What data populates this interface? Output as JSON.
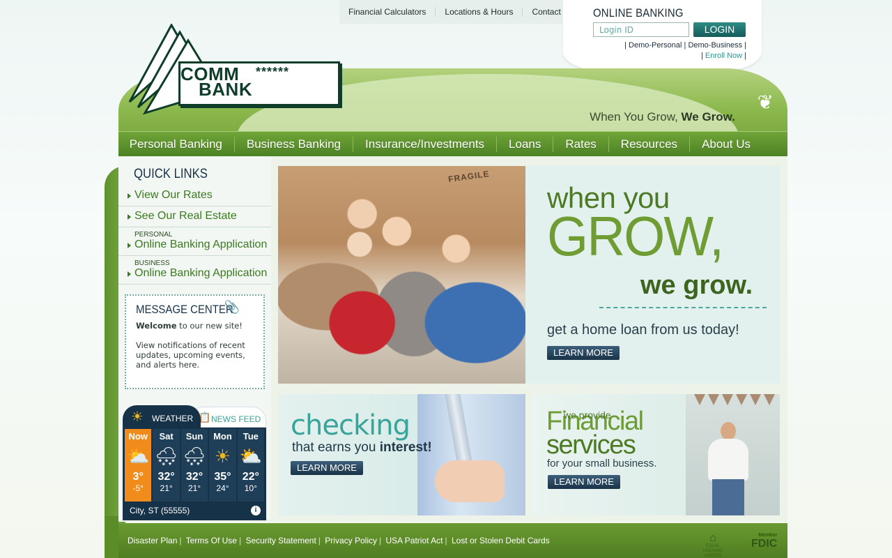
{
  "util_nav": [
    "Financial Calculators",
    "Locations & Hours",
    "Contact Us"
  ],
  "online_banking": {
    "title": "ONLINE BANKING",
    "login_placeholder": "Login ID",
    "login_button": "LOGIN",
    "links": [
      "Demo-Personal",
      "Demo-Business",
      "Enroll Now"
    ]
  },
  "logo": {
    "line1": "COMM",
    "stars": "******",
    "line2": "BANK"
  },
  "tagline": {
    "part1": "When You Grow,",
    "part2": "We Grow."
  },
  "main_nav": [
    "Personal Banking",
    "Business Banking",
    "Insurance/Investments",
    "Loans",
    "Rates",
    "Resources",
    "About Us"
  ],
  "quick_links": {
    "title": "QUICK LINKS",
    "items": [
      {
        "small": "",
        "label": "View Our Rates"
      },
      {
        "small": "",
        "label": "See Our Real Estate"
      },
      {
        "small": "PERSONAL",
        "label": "Online Banking Application"
      },
      {
        "small": "BUSINESS",
        "label": "Online Banking Application"
      }
    ]
  },
  "message_center": {
    "title": "MESSAGE CENTER",
    "welcome_bold": "Welcome",
    "welcome_rest": " to our new site!",
    "body": "View notifications of recent updates, upcoming events, and alerts here."
  },
  "weather": {
    "tab_weather": "WEATHER",
    "tab_news": "NEWS FEED",
    "days": [
      {
        "name": "Now",
        "icon": "partly-cloudy-icon",
        "hi": "3°",
        "lo": "-5°"
      },
      {
        "name": "Sat",
        "icon": "snow-cloud-icon",
        "hi": "32°",
        "lo": "21°"
      },
      {
        "name": "Sun",
        "icon": "snow-cloud-icon",
        "hi": "32°",
        "lo": "21°"
      },
      {
        "name": "Mon",
        "icon": "sun-icon",
        "hi": "35°",
        "lo": "24°"
      },
      {
        "name": "Tue",
        "icon": "partly-cloudy-icon",
        "hi": "22°",
        "lo": "10°"
      }
    ],
    "location": "City, ST (55555)"
  },
  "banner": {
    "fragile": "FRAGILE",
    "line1": "when you",
    "grow": "GROW,",
    "we_grow": "we grow.",
    "cta_text": "get a home loan from us today!",
    "learn_more": "LEARN MORE"
  },
  "checking_tile": {
    "headline": "checking",
    "sub_pre": "that earns you ",
    "sub_bold": "interest!",
    "learn_more": "LEARN MORE"
  },
  "financial_tile": {
    "small": "we provide",
    "big1": "Financial",
    "big2": "services",
    "sub": "for your small business.",
    "learn_more": "LEARN MORE"
  },
  "footer": {
    "links": [
      "Disaster Plan",
      "Terms Of Use",
      "Security Statement",
      "Privacy Policy",
      "USA Patriot Act",
      "Lost or Stolen Debit Cards"
    ],
    "ehl": "EQUAL HOUSING LENDER",
    "fdic_member": "Member",
    "fdic": "FDIC"
  },
  "colors": {
    "brand_green": "#6f9d34",
    "navy": "#163248",
    "teal": "#39a49a",
    "orange_now": "#f08c1c"
  }
}
